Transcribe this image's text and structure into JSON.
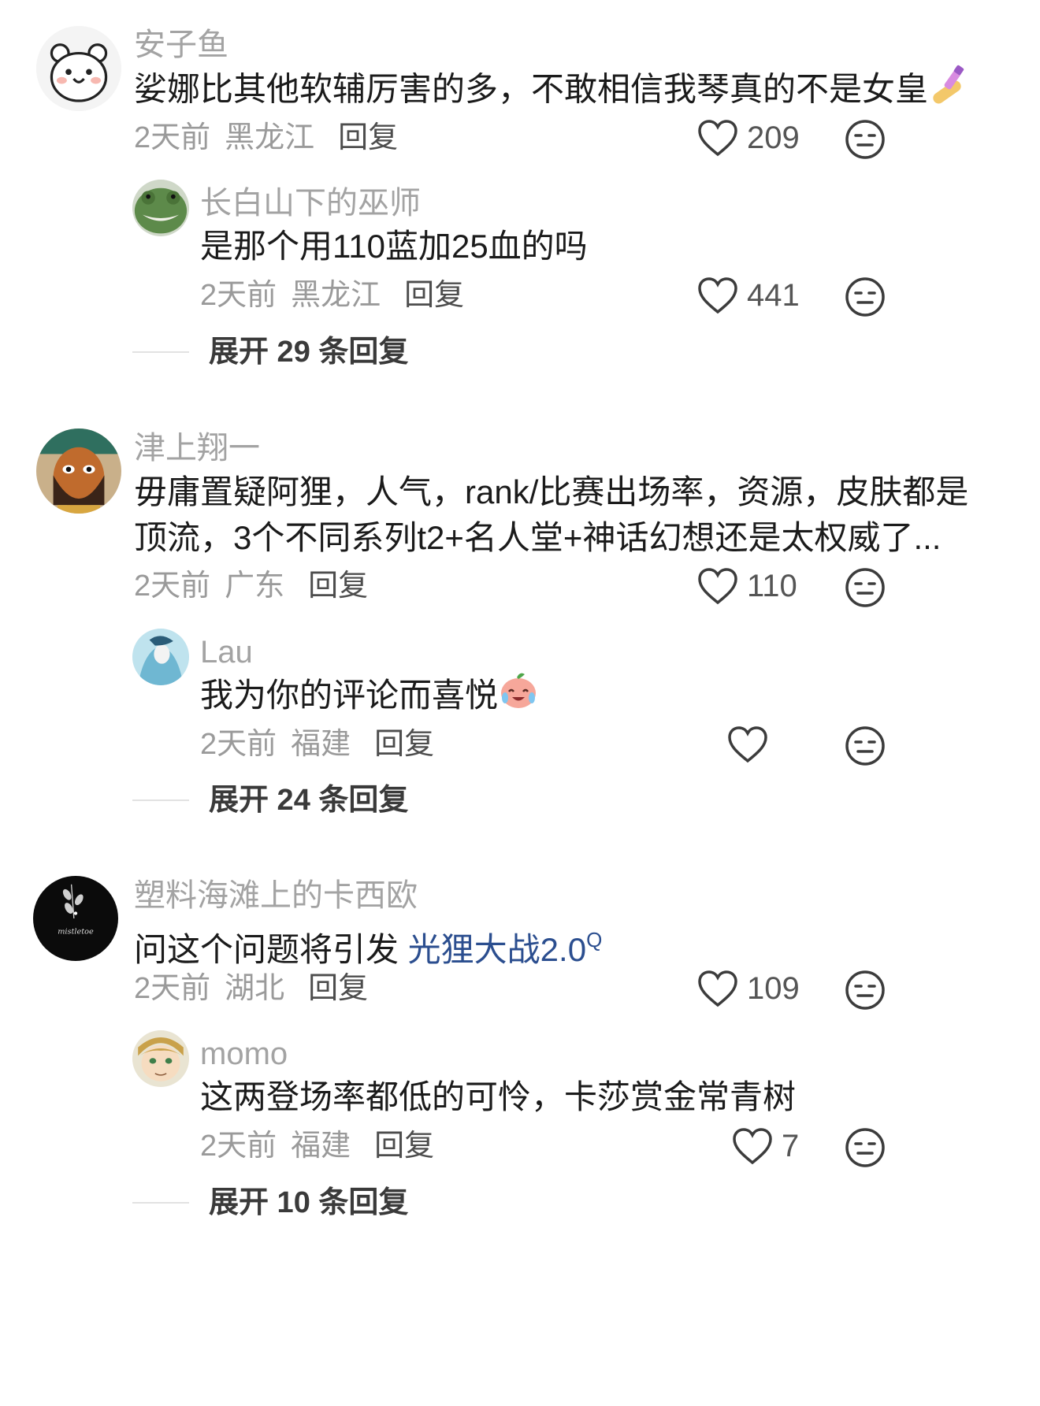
{
  "comments": [
    {
      "username": "安子鱼",
      "text": "娑娜比其他软辅厉害的多，不敢相信我琴真的不是女皇",
      "emoji": "nail-polish-emoji",
      "time": "2天前",
      "location": "黑龙江",
      "reply_label": "回复",
      "likes": "209",
      "replies": [
        {
          "username": "长白山下的巫师",
          "text": "是那个用110蓝加25血的吗",
          "time": "2天前",
          "location": "黑龙江",
          "reply_label": "回复",
          "likes": "441"
        }
      ],
      "expand_label": "展开 29 条回复"
    },
    {
      "username": "津上翔一",
      "text_line1": "毋庸置疑阿狸，人气，rank/比赛出场率，资源，皮肤都是",
      "text_line2": "顶流，3个不同系列t2+名人堂+神话幻想还是太权威了...",
      "time": "2天前",
      "location": "广东",
      "reply_label": "回复",
      "likes": "110",
      "replies": [
        {
          "username": "Lau",
          "text": "我为你的评论而喜悦",
          "emoji": "crying-laughing-peach-emoji",
          "time": "2天前",
          "location": "福建",
          "reply_label": "回复",
          "likes": ""
        }
      ],
      "expand_label": "展开 24 条回复"
    },
    {
      "username": "塑料海滩上的卡西欧",
      "text_prefix": "问这个问题将引发 ",
      "link_text": "光狸大战2.0",
      "link_mark": "Q",
      "avatar_text": "mistletoe",
      "time": "2天前",
      "location": "湖北",
      "reply_label": "回复",
      "likes": "109",
      "replies": [
        {
          "username": "momo",
          "text": "这两登场率都低的可怜，卡莎赏金常青树",
          "time": "2天前",
          "location": "福建",
          "reply_label": "回复",
          "likes": "7"
        }
      ],
      "expand_label": "展开 10 条回复"
    }
  ],
  "colors": {
    "username": "#a3a3a3",
    "text": "#1b1b1b",
    "meta": "#9a9a9a",
    "link": "#2b4e8f",
    "icon": "#3c3c3c"
  }
}
